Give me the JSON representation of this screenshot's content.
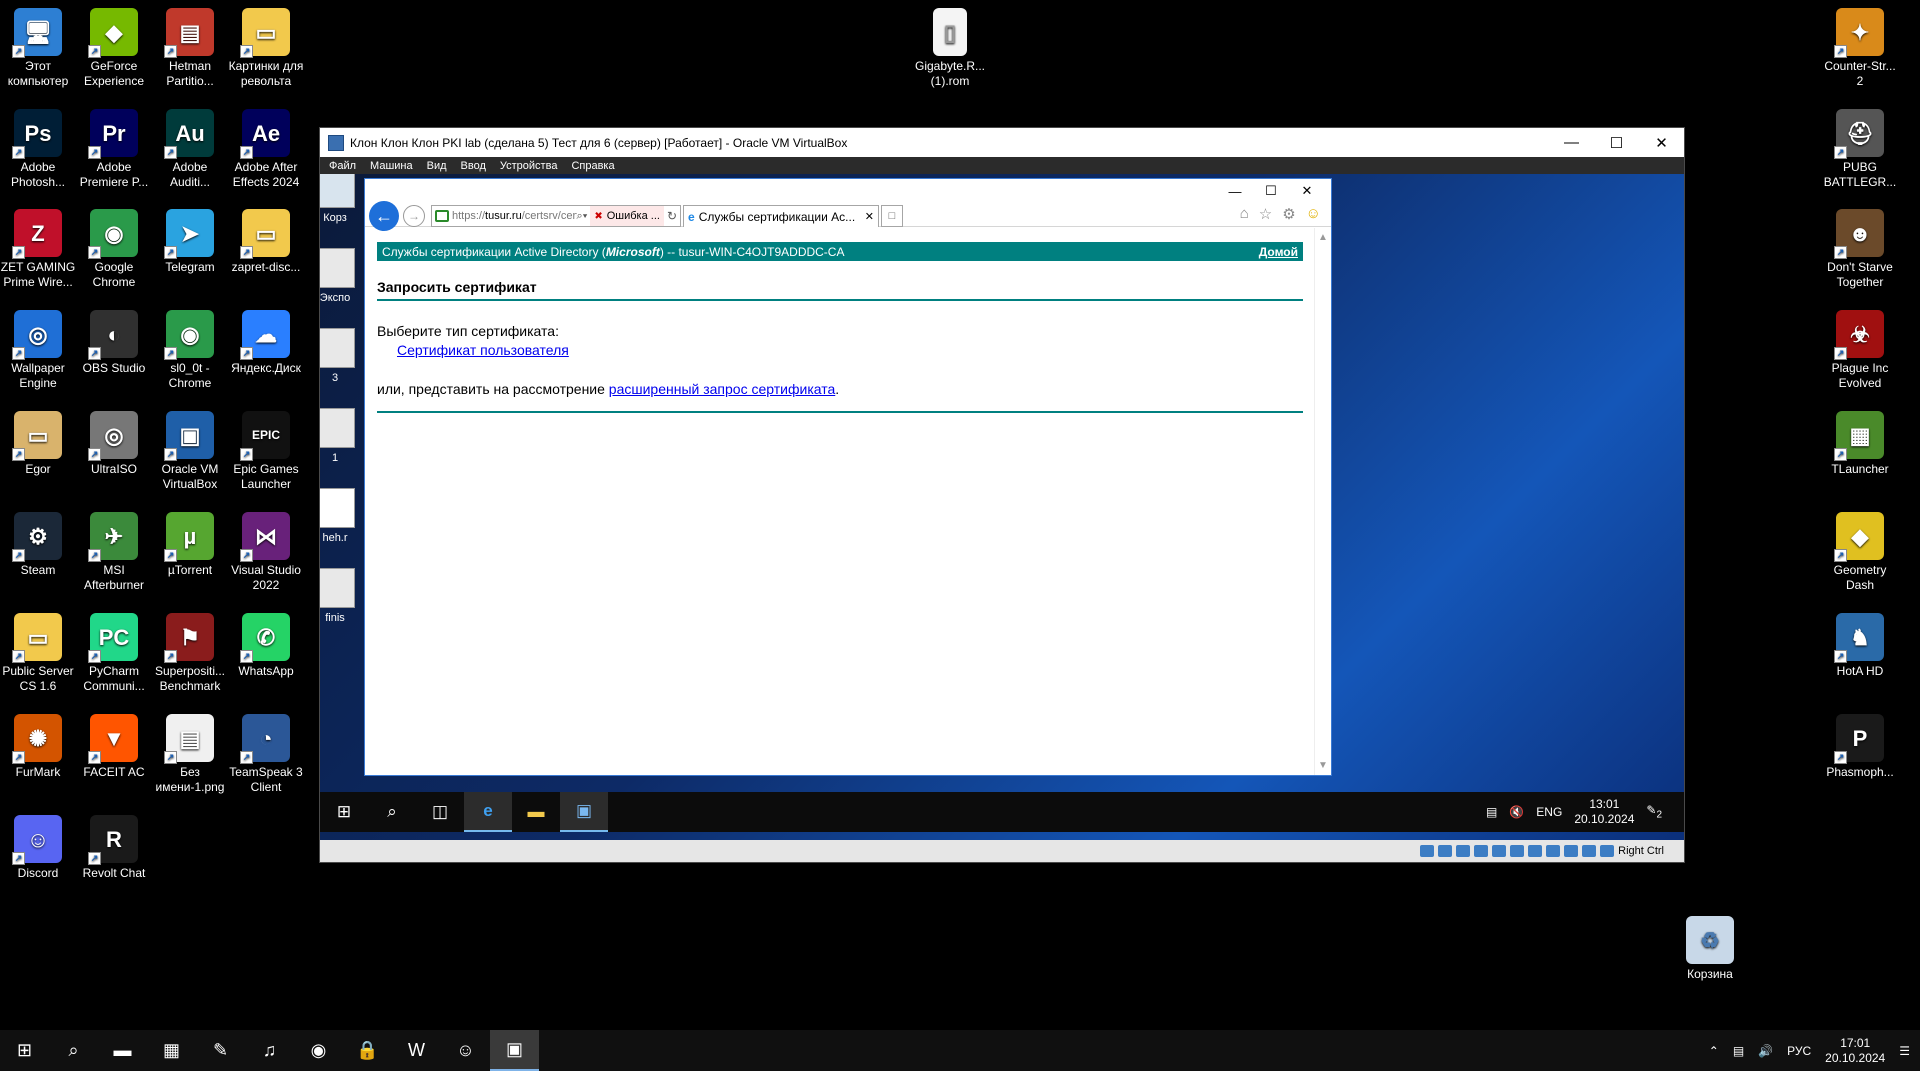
{
  "host_desktop": {
    "icons_left": [
      {
        "label": "Этот компьютер",
        "icon": "computer-icon",
        "color": "#2d7fd3",
        "glyph": "🖥"
      },
      {
        "label": "GeForce Experience",
        "icon": "nvidia-icon",
        "color": "#76b900",
        "glyph": "◆"
      },
      {
        "label": "Hetman Partitio...",
        "icon": "hetman-icon",
        "color": "#c0392b",
        "glyph": "▤"
      },
      {
        "label": "Картинки для револьта",
        "icon": "folder-icon",
        "color": "#f2c94c",
        "glyph": "▭"
      },
      {
        "label": "Adobe Photosh...",
        "icon": "photoshop-icon",
        "color": "#001e36",
        "glyph": "Ps"
      },
      {
        "label": "Adobe Premiere P...",
        "icon": "premiere-icon",
        "color": "#00005b",
        "glyph": "Pr"
      },
      {
        "label": "Adobe Auditi...",
        "icon": "audition-icon",
        "color": "#003b3b",
        "glyph": "Au"
      },
      {
        "label": "Adobe After Effects 2024",
        "icon": "after-effects-icon",
        "color": "#00005b",
        "glyph": "Ae"
      },
      {
        "label": "ZET GAMING Prime Wire...",
        "icon": "zet-gaming-icon",
        "color": "#c0102a",
        "glyph": "Z"
      },
      {
        "label": "Google Chrome",
        "icon": "chrome-icon",
        "color": "#2a9a4a",
        "glyph": "◉"
      },
      {
        "label": "Telegram",
        "icon": "telegram-icon",
        "color": "#2aa3e0",
        "glyph": "➤"
      },
      {
        "label": "zapret-disc...",
        "icon": "folder-icon",
        "color": "#f2c94c",
        "glyph": "▭"
      },
      {
        "label": "Wallpaper Engine",
        "icon": "wallpaper-engine-icon",
        "color": "#1f6fd6",
        "glyph": "◎"
      },
      {
        "label": "OBS Studio",
        "icon": "obs-icon",
        "color": "#303030",
        "glyph": "◐"
      },
      {
        "label": "sl0_0t - Chrome",
        "icon": "chrome-profile-icon",
        "color": "#2a9a4a",
        "glyph": "◉"
      },
      {
        "label": "Яндекс.Диск",
        "icon": "yandex-disk-icon",
        "color": "#2a7fff",
        "glyph": "☁"
      },
      {
        "label": "Egor",
        "icon": "folder-icon",
        "color": "#d9b36c",
        "glyph": "▭"
      },
      {
        "label": "UltraISO",
        "icon": "ultraiso-icon",
        "color": "#777777",
        "glyph": "◎"
      },
      {
        "label": "Oracle VM VirtualBox",
        "icon": "virtualbox-icon",
        "color": "#1f5fa8",
        "glyph": "▣"
      },
      {
        "label": "Epic Games Launcher",
        "icon": "epic-games-icon",
        "color": "#111111",
        "glyph": "EPIC"
      },
      {
        "label": "Steam",
        "icon": "steam-icon",
        "color": "#1b2838",
        "glyph": "⚙"
      },
      {
        "label": "MSI Afterburner",
        "icon": "msi-afterburner-icon",
        "color": "#3b8a3b",
        "glyph": "✈"
      },
      {
        "label": "µTorrent",
        "icon": "utorrent-icon",
        "color": "#56a630",
        "glyph": "µ"
      },
      {
        "label": "Visual Studio 2022",
        "icon": "visual-studio-icon",
        "color": "#68217a",
        "glyph": "⋈"
      },
      {
        "label": "Public Server CS 1.6",
        "icon": "folder-icon",
        "color": "#f2c94c",
        "glyph": "▭"
      },
      {
        "label": "PyCharm Communi...",
        "icon": "pycharm-icon",
        "color": "#21d789",
        "glyph": "PC"
      },
      {
        "label": "Superpositi... Benchmark",
        "icon": "superposition-icon",
        "color": "#8a1c1c",
        "glyph": "⚑"
      },
      {
        "label": "WhatsApp",
        "icon": "whatsapp-icon",
        "color": "#25d366",
        "glyph": "✆"
      },
      {
        "label": "FurMark",
        "icon": "furmark-icon",
        "color": "#d35400",
        "glyph": "✺"
      },
      {
        "label": "FACEIT AC",
        "icon": "faceit-icon",
        "color": "#ff5500",
        "glyph": "▼"
      },
      {
        "label": "Без имени-1.png",
        "icon": "image-file-icon",
        "color": "#f0f0f0",
        "glyph": "▤"
      },
      {
        "label": "TeamSpeak 3 Client",
        "icon": "teamspeak-icon",
        "color": "#2b5797",
        "glyph": "◔"
      },
      {
        "label": "Discord",
        "icon": "discord-icon",
        "color": "#5865f2",
        "glyph": "☺"
      },
      {
        "label": "Revolt Chat",
        "icon": "revolt-icon",
        "color": "#1a1a1a",
        "glyph": "R"
      }
    ],
    "icons_right": [
      {
        "label": "Counter-Str... 2",
        "icon": "cs2-icon",
        "color": "#d98a1a",
        "glyph": "✦"
      },
      {
        "label": "PUBG BATTLEGR...",
        "icon": "pubg-icon",
        "color": "#555555",
        "glyph": "⛑"
      },
      {
        "label": "Don't Starve Together",
        "icon": "dont-starve-icon",
        "color": "#6b4a2a",
        "glyph": "☻"
      },
      {
        "label": "Plague Inc Evolved",
        "icon": "plague-inc-icon",
        "color": "#a01010",
        "glyph": "☣"
      },
      {
        "label": "TLauncher",
        "icon": "tlauncher-icon",
        "color": "#4a8a2a",
        "glyph": "▦"
      },
      {
        "label": "Geometry Dash",
        "icon": "geometry-dash-icon",
        "color": "#e0c020",
        "glyph": "◆"
      },
      {
        "label": "HotA HD",
        "icon": "hota-icon",
        "color": "#2a6aa8",
        "glyph": "♞"
      },
      {
        "label": "Phasmoph...",
        "icon": "phasmophobia-icon",
        "color": "#1a1a1a",
        "glyph": "P"
      }
    ],
    "icon_top_file": {
      "label": "Gigabyte.R... (1).rom",
      "icon": "file-icon"
    },
    "recycle_bin": {
      "label": "Корзина",
      "icon": "recycle-bin-icon"
    }
  },
  "host_taskbar": {
    "apps": [
      {
        "name": "start",
        "glyph": "⊞"
      },
      {
        "name": "search",
        "glyph": "⌕"
      },
      {
        "name": "explorer",
        "glyph": "▬"
      },
      {
        "name": "calculator",
        "glyph": "▦"
      },
      {
        "name": "paint",
        "glyph": "✎"
      },
      {
        "name": "music",
        "glyph": "♫"
      },
      {
        "name": "chrome",
        "glyph": "◉"
      },
      {
        "name": "keepass",
        "glyph": "🔒"
      },
      {
        "name": "word",
        "glyph": "W"
      },
      {
        "name": "discord",
        "glyph": "☺"
      },
      {
        "name": "virtualbox",
        "glyph": "▣"
      }
    ],
    "lang": "РУС",
    "time": "17:01",
    "date": "20.10.2024"
  },
  "vbox": {
    "title": "Клон Клон Клон PKI lab (сделана 5) Тест для 6 (сервер) [Работает] - Oracle VM VirtualBox",
    "menu": [
      "Файл",
      "Машина",
      "Вид",
      "Ввод",
      "Устройства",
      "Справка"
    ],
    "host_key": "Right Ctrl"
  },
  "guest": {
    "desktop_icons": [
      "Корз",
      "Экспо",
      "3",
      "1",
      "heh.r",
      "finis"
    ],
    "taskbar": {
      "lang": "ENG",
      "time": "13:01",
      "date": "20.10.2024",
      "notifications": "2"
    }
  },
  "browser": {
    "url_prefix": "https://",
    "url_domain": "tusur.ru",
    "url_rest": "/certsrv/cert",
    "cert_error": "Ошибка ...",
    "tab_title": "Службы сертификации Ac..."
  },
  "page": {
    "header_left_prefix": "Службы сертификации Active Directory (",
    "header_brand": "Microsoft",
    "header_left_suffix": ")  --  tusur-WIN-C4OJT9ADDDC-CA",
    "home_link": "Домой",
    "title": "Запросить сертификат",
    "choose_type": "Выберите тип сертификата:",
    "user_cert_link": "Сертификат пользователя",
    "or_submit": "или, представить на рассмотрение ",
    "advanced_link": "расширенный запрос сертификата",
    "period": "."
  },
  "colors": {
    "accent_teal": "#008080",
    "link": "#0000ee",
    "ie_blue": "#1e6fd9"
  }
}
